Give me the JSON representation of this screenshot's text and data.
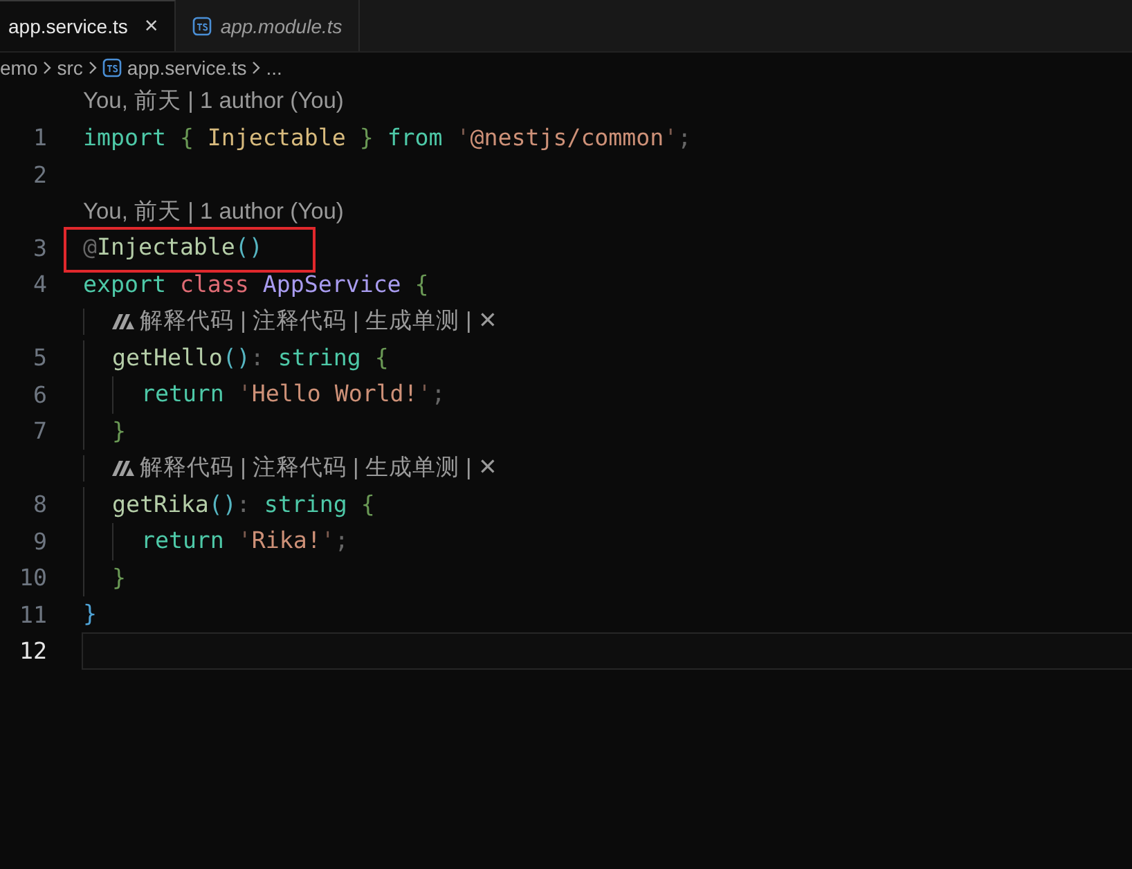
{
  "tabs": [
    {
      "label": "app.service.ts",
      "selected": true,
      "italic": false,
      "close": "×"
    },
    {
      "label": "app.module.ts",
      "selected": false,
      "italic": true
    }
  ],
  "breadcrumb": [
    "emo",
    "src",
    "app.service.ts",
    "..."
  ],
  "lines": [
    {
      "number": "1",
      "lens": {
        "kind": "blame",
        "text": "You, 前天 | 1 author (You)"
      },
      "tokens": [
        {
          "t": "import ",
          "kind": "keyword"
        },
        {
          "t": "{ ",
          "kind": "brace"
        },
        {
          "t": "Injectable ",
          "kind": "name"
        },
        {
          "t": "} ",
          "kind": "brace"
        },
        {
          "t": "from ",
          "kind": "keyword"
        },
        {
          "t": "'",
          "kind": "quote"
        },
        {
          "t": "@nestjs/common",
          "kind": "string"
        },
        {
          "t": "'",
          "kind": "quote"
        },
        {
          "t": ";",
          "kind": "punct"
        }
      ],
      "highlighted": false,
      "current": false
    },
    {
      "number": "2",
      "highlighted": false,
      "current": false
    },
    {
      "number": "3",
      "lens": {
        "kind": "blame",
        "text": "You, 前天 | 1 author (You)"
      },
      "tokens": [
        {
          "t": "@",
          "kind": "punct"
        },
        {
          "t": "Injectable",
          "kind": "function"
        },
        {
          "t": "()",
          "kind": "paren"
        }
      ],
      "highlighted": true,
      "current": false
    },
    {
      "number": "4",
      "tokens": [
        {
          "t": "export ",
          "kind": "keyword"
        },
        {
          "t": "class ",
          "kind": "storage"
        },
        {
          "t": "AppService ",
          "kind": "class"
        },
        {
          "t": "{",
          "kind": "brace"
        }
      ],
      "highlighted": false,
      "current": false
    },
    {
      "number": "5",
      "lens": {
        "kind": "ai",
        "text": "解释代码 | 注释代码 | 生成单测 | ✕"
      },
      "tokens": [
        {
          "t": "  getHello",
          "kind": "function"
        },
        {
          "t": "()",
          "kind": "paren"
        },
        {
          "t": ": ",
          "kind": "punct"
        },
        {
          "t": "string ",
          "kind": "type"
        },
        {
          "t": "{",
          "kind": "brace"
        }
      ],
      "highlighted": false,
      "current": false
    },
    {
      "number": "6",
      "tokens": [
        {
          "t": "    return ",
          "kind": "keyword"
        },
        {
          "t": "'",
          "kind": "quote"
        },
        {
          "t": "Hello World!",
          "kind": "string"
        },
        {
          "t": "'",
          "kind": "quote"
        },
        {
          "t": ";",
          "kind": "punct"
        }
      ],
      "highlighted": false,
      "current": false
    },
    {
      "number": "7",
      "tokens": [
        {
          "t": "  }",
          "kind": "brace"
        }
      ],
      "highlighted": false,
      "current": false
    },
    {
      "number": "8",
      "lens": {
        "kind": "ai",
        "text": "解释代码 | 注释代码 | 生成单测 | ✕"
      },
      "tokens": [
        {
          "t": "  getRika",
          "kind": "function"
        },
        {
          "t": "()",
          "kind": "paren"
        },
        {
          "t": ": ",
          "kind": "punct"
        },
        {
          "t": "string ",
          "kind": "type"
        },
        {
          "t": "{",
          "kind": "brace"
        }
      ],
      "highlighted": false,
      "current": false
    },
    {
      "number": "9",
      "tokens": [
        {
          "t": "    return ",
          "kind": "keyword"
        },
        {
          "t": "'",
          "kind": "quote"
        },
        {
          "t": "Rika!",
          "kind": "string"
        },
        {
          "t": "'",
          "kind": "quote"
        },
        {
          "t": ";",
          "kind": "punct"
        }
      ],
      "highlighted": false,
      "current": false
    },
    {
      "number": "10",
      "tokens": [
        {
          "t": "  }",
          "kind": "brace"
        }
      ],
      "highlighted": false,
      "current": false
    },
    {
      "number": "11",
      "tokens": [
        {
          "t": "}",
          "kind": "brace2"
        }
      ],
      "highlighted": false,
      "current": false
    },
    {
      "number": "12",
      "highlighted": false,
      "current": true
    }
  ]
}
